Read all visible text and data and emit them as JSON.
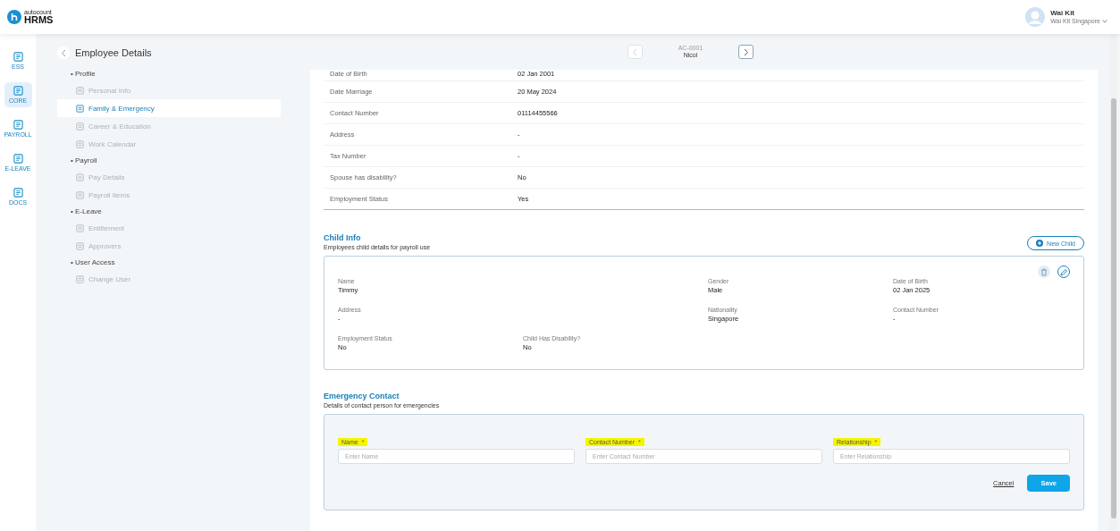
{
  "header": {
    "logo_small": "autocount",
    "logo_big": "HRMS",
    "user_name": "Wai Kit",
    "user_company": "Wai Kit Singapore"
  },
  "rail": [
    {
      "label": "ESS",
      "selected": false
    },
    {
      "label": "CORE",
      "selected": true
    },
    {
      "label": "PAYROLL",
      "selected": false
    },
    {
      "label": "E-LEAVE",
      "selected": false
    },
    {
      "label": "DOCS",
      "selected": false
    }
  ],
  "sidebar": {
    "title": "Employee Details",
    "groups": [
      {
        "heading": "• Profile",
        "items": [
          {
            "label": "Personal Info",
            "selected": false
          },
          {
            "label": "Family & Emergency",
            "selected": true
          },
          {
            "label": "Career & Education",
            "selected": false
          },
          {
            "label": "Work Calendar",
            "selected": false
          }
        ]
      },
      {
        "heading": "• Payroll",
        "items": [
          {
            "label": "Pay Details",
            "selected": false
          },
          {
            "label": "Payroll Items",
            "selected": false
          }
        ]
      },
      {
        "heading": "• E-Leave",
        "items": [
          {
            "label": "Entitlement",
            "selected": false
          },
          {
            "label": "Approvers",
            "selected": false
          }
        ]
      },
      {
        "heading": "• User Access",
        "items": [
          {
            "label": "Change User",
            "selected": false
          }
        ]
      }
    ]
  },
  "employee_nav": {
    "code": "AC-0001",
    "name": "Nicol",
    "prev_disabled": true,
    "next_disabled": false
  },
  "spouse_rows": [
    {
      "label": "Date of Birth",
      "value": "02 Jan 2001"
    },
    {
      "label": "Date Marriage",
      "value": "20 May 2024"
    },
    {
      "label": "Contact Number",
      "value": "01114455566"
    },
    {
      "label": "Address",
      "value": "-"
    },
    {
      "label": "Tax Number",
      "value": "-"
    },
    {
      "label": "Spouse has disability?",
      "value": "No"
    },
    {
      "label": "Employment Status",
      "value": "Yes"
    }
  ],
  "child_info": {
    "title": "Child Info",
    "subtitle": "Employees child details for payroll use",
    "new_button": "New Child",
    "rows": [
      [
        {
          "label": "Name",
          "value": "Timmy"
        },
        {
          "label": "Gender",
          "value": "Male"
        },
        {
          "label": "Date of Birth",
          "value": "02 Jan 2025"
        }
      ],
      [
        {
          "label": "Address",
          "value": "-"
        },
        {
          "label": "Nationality",
          "value": "Singapore"
        },
        {
          "label": "Contact Number",
          "value": "-"
        }
      ],
      [
        {
          "label": "Employment Status",
          "value": "No"
        },
        {
          "label": "Child Has Disability?",
          "value": "No"
        }
      ]
    ]
  },
  "emergency_contact": {
    "title": "Emergency Contact",
    "subtitle": "Details of contact person for emergencies",
    "fields": [
      {
        "label": "Name",
        "required_mark": "*",
        "highlighted": true,
        "placeholder": "Enter Name"
      },
      {
        "label": "Contact Number",
        "required_mark": "*",
        "highlighted": true,
        "placeholder": "Enter Contact Number"
      },
      {
        "label": "Relationship",
        "required_mark": "*",
        "highlighted": true,
        "placeholder": "Enter Relationship"
      }
    ],
    "cancel": "Cancel",
    "save": "Save"
  }
}
